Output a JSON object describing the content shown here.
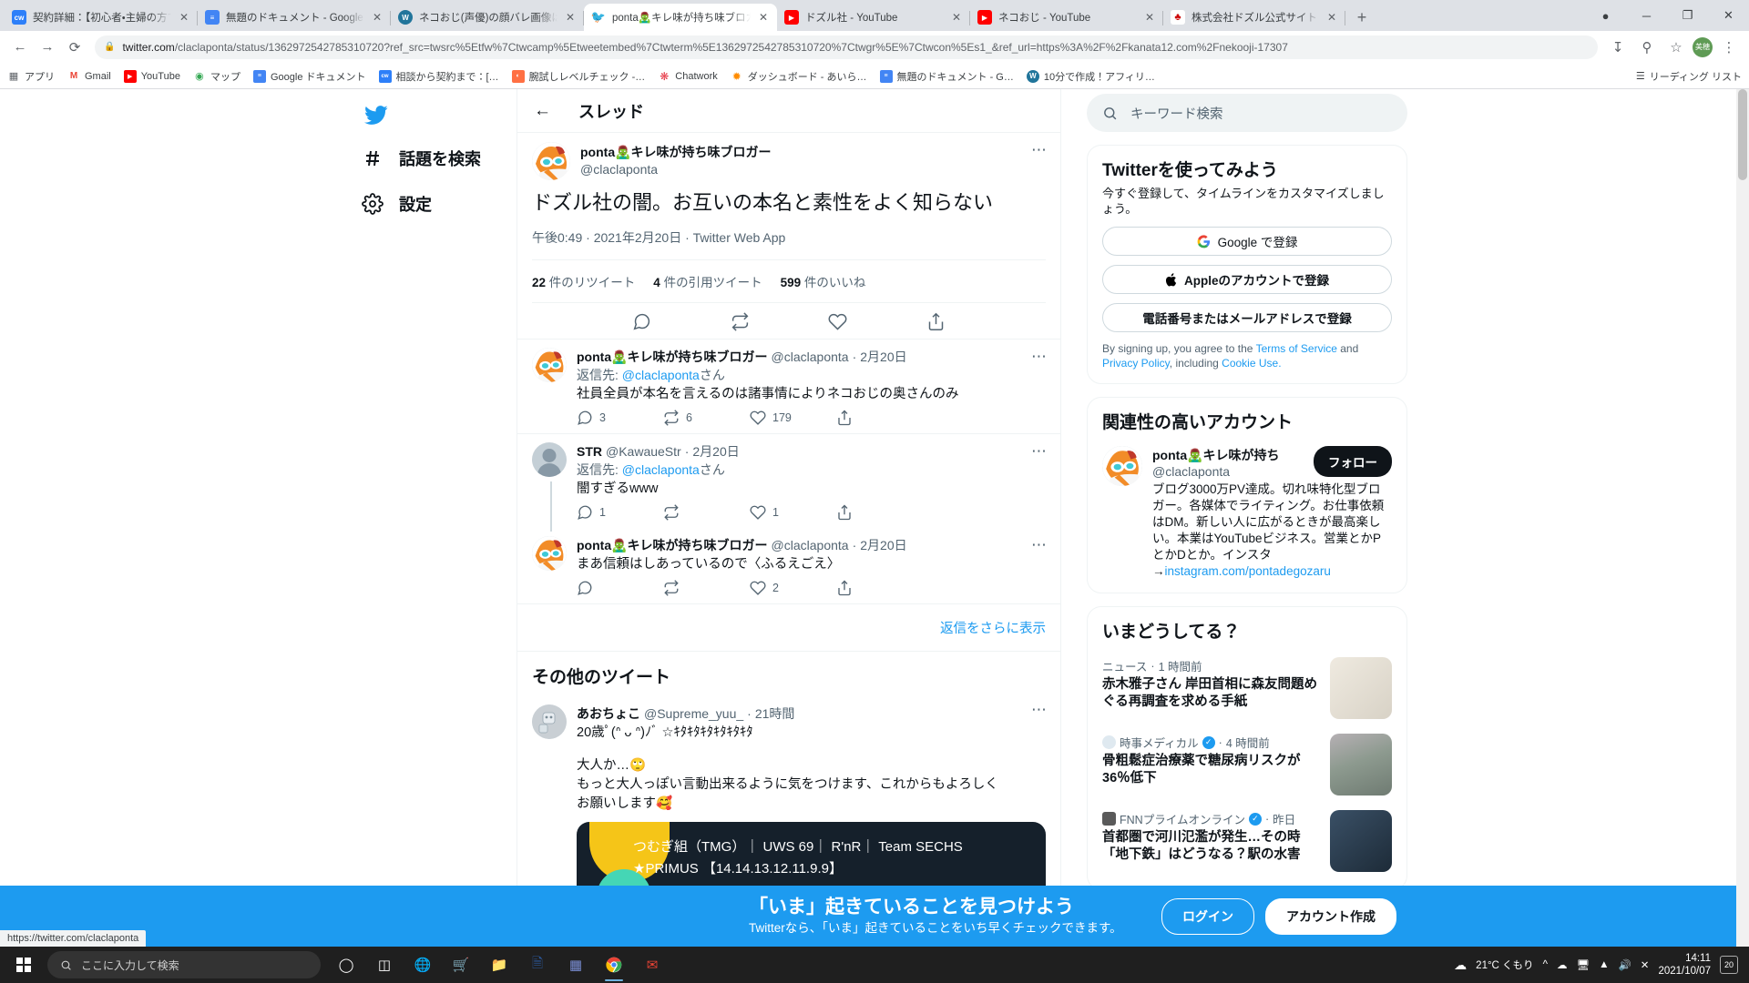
{
  "browser": {
    "tabs": [
      {
        "title": "契約詳細：【初心者・主婦の方でも",
        "favicon_text": "cw",
        "favicon_color": "#2d7ff9",
        "active": false
      },
      {
        "title": "無題のドキュメント - Google ドキュメ",
        "favicon_text": "≡",
        "favicon_color": "#4285f4",
        "active": false
      },
      {
        "title": "ネコおじ(声優)の顔バレ画像は？年",
        "favicon_text": "W",
        "favicon_color": "#21759b",
        "active": false
      },
      {
        "title": "ponta🧟‍♂️キレ味が持ち味ブロガーさん",
        "favicon_text": "t",
        "favicon_color": "#1d9bf0",
        "active": true
      },
      {
        "title": "ドズル社 - YouTube",
        "favicon_text": "▶",
        "favicon_color": "#ff0000",
        "active": false
      },
      {
        "title": "ネコおじ - YouTube",
        "favicon_text": "▶",
        "favicon_color": "#ff0000",
        "active": false
      },
      {
        "title": "株式会社ドズル公式サイト | クリエイ",
        "favicon_text": "♣",
        "favicon_color": "#e8e8e8",
        "active": false
      }
    ],
    "close_label": "✕",
    "newtab_label": "+",
    "window_controls": {
      "minimize": "─",
      "maximize": "❐",
      "close": "✕"
    },
    "url_host": "twitter.com",
    "url_rest": "/claclaponta/status/1362972542785310720?ref_src=twsrc%5Etfw%7Ctwcamp%5Etweetembed%7Ctwterm%5E1362972542785310720%7Ctwgr%5E%7Ctwcon%5Es1_&ref_url=https%3A%2F%2Fkanata12.com%2Fnekooji-17307",
    "nav": {
      "back": "←",
      "forward": "→",
      "reload": "⟳"
    },
    "lock_icon": "🔒",
    "profile_initial": "美穂",
    "bookmarks": [
      {
        "label": "アプリ",
        "icon": "⁞⁞⁞",
        "color": "transparent"
      },
      {
        "label": "Gmail",
        "icon": "M",
        "color": "#ffffff"
      },
      {
        "label": "YouTube",
        "icon": "▶",
        "color": "#ff0000"
      },
      {
        "label": "マップ",
        "icon": "◈",
        "color": "#ffffff"
      },
      {
        "label": "Google ドキュメント",
        "icon": "≡",
        "color": "#4285f4"
      },
      {
        "label": "相談から契約まで：[…",
        "icon": "cw",
        "color": "#2d7ff9"
      },
      {
        "label": "腕試しレベルチェック -…",
        "icon": "◐",
        "color": "#ff7043"
      },
      {
        "label": "Chatwork",
        "icon": "❋",
        "color": "#ffffff"
      },
      {
        "label": "ダッシュボード - あいら…",
        "icon": "✹",
        "color": "#ff8c00"
      },
      {
        "label": "無題のドキュメント - G…",
        "icon": "≡",
        "color": "#4285f4"
      },
      {
        "label": "10分で作成！アフィリ…",
        "icon": "W",
        "color": "#21759b"
      }
    ],
    "reading_list": "リーディング リスト",
    "status_bar_url": "https://twitter.com/claclaponta"
  },
  "leftnav": {
    "logo": "twitter-bird",
    "items": [
      {
        "icon": "#",
        "label": "話題を検索"
      },
      {
        "icon": "gear",
        "label": "設定"
      }
    ]
  },
  "thread": {
    "header_title": "スレッド",
    "back_icon": "←",
    "main_tweet": {
      "display_name": "ponta🧟‍♂️キレ味が持ち味ブロガー",
      "handle": "@claclaponta",
      "text": "ドズル社の闇。お互いの本名と素性をよく知らない",
      "meta": "午後0:49 · 2021年2月20日 · Twitter Web App",
      "stats": [
        {
          "count": "22",
          "label": "件のリツイート"
        },
        {
          "count": "4",
          "label": "件の引用ツイート"
        },
        {
          "count": "599",
          "label": "件のいいね"
        }
      ],
      "actions": [
        "reply-icon",
        "retweet-icon",
        "like-icon",
        "share-icon"
      ]
    },
    "replies": [
      {
        "display_name": "ponta🧟‍♂️キレ味が持ち味ブロガー",
        "handle": "@claclaponta",
        "date": "2月20日",
        "reply_to_prefix": "返信先:",
        "reply_to": "@claclaponta",
        "reply_to_suffix": "さん",
        "text": "社員全員が本名を言えるのは諸事情によりネコおじの奥さんのみ",
        "avatar": "ponta",
        "show_reply_to": true,
        "thread_line": false,
        "counts": {
          "reply": "3",
          "retweet": "6",
          "like": "179",
          "share": ""
        }
      },
      {
        "display_name": "STR",
        "handle": "@KawaueStr",
        "date": "2月20日",
        "reply_to_prefix": "返信先:",
        "reply_to": "@claclaponta",
        "reply_to_suffix": "さん",
        "text": "闇すぎるwww",
        "avatar": "default",
        "show_reply_to": true,
        "thread_line": true,
        "counts": {
          "reply": "1",
          "retweet": "",
          "like": "1",
          "share": ""
        }
      },
      {
        "display_name": "ponta🧟‍♂️キレ味が持ち味ブロガー",
        "handle": "@claclaponta",
        "date": "2月20日",
        "reply_to_prefix": "",
        "reply_to": "",
        "reply_to_suffix": "",
        "text": "まあ信頼はしあっているので〈ふるえごえ〉",
        "avatar": "ponta",
        "show_reply_to": false,
        "thread_line": false,
        "counts": {
          "reply": "",
          "retweet": "",
          "like": "2",
          "share": ""
        }
      }
    ],
    "show_more_replies": "返信をさらに表示",
    "other_tweets_title": "その他のツイート",
    "other_tweet": {
      "display_name": "あおちょこ",
      "handle": "@Supreme_yuu_",
      "date": "21時間",
      "bio_line": "20歳ﾟ(ᐢ ᴗ ᐢ)ﾉﾞ ☆ｷﾀｷﾀｷﾀｷﾀｷﾀｷﾀ",
      "text_lines": [
        "大人か…🙄",
        "もっと大人っぽい言動出来るように気をつけます、これからもよろしく",
        "お願いします🥰"
      ],
      "card_line1": "つむぎ組（TMG）｜ UWS 69｜ R'nR｜ Team SECHS",
      "card_line2": "★PRIMUS 【14.14.13.12.11.9.9】"
    }
  },
  "sidebar": {
    "search_placeholder": "キーワード検索",
    "search_icon": "search-icon",
    "signup_card": {
      "title": "Twitterを使ってみよう",
      "subtitle": "今すぐ登録して、タイムラインをカスタマイズしましょう。",
      "google_button": "Google で登録",
      "apple_button": "Appleのアカウントで登録",
      "phone_button": "電話番号またはメールアドレスで登録",
      "legal_pre": "By signing up, you agree to the ",
      "legal_tos": "Terms of Service",
      "legal_and": " and ",
      "legal_privacy": "Privacy Policy",
      "legal_incl": ", including ",
      "legal_cookie": "Cookie Use."
    },
    "relevant_accounts": {
      "title": "関連性の高いアカウント",
      "account": {
        "display_name": "ponta🧟‍♂️キレ味が持ち",
        "handle": "@claclaponta",
        "follow_label": "フォロー",
        "bio": "ブログ3000万PV達成。切れ味特化型ブロガー。各媒体でライティング。お仕事依頼はDM。新しい人に広がるときが最高楽しい。本業はYouTubeビジネス。営業とかPとかDとか。インスタ",
        "link_arrow": "→",
        "link": "instagram.com/pontadegozaru"
      }
    },
    "trends": {
      "title": "いまどうしてる？",
      "items": [
        {
          "source": "ニュース",
          "verified": false,
          "has_icon": false,
          "time": "1 時間前",
          "headline": "赤木雅子さん 岸田首相に森友問題めぐる再調査を求める手紙",
          "thumb_color": "#e8e2d8"
        },
        {
          "source": "時事メディカル",
          "verified": true,
          "has_icon": true,
          "time": "4 時間前",
          "headline": "骨粗鬆症治療薬で糖尿病リスクが36％低下",
          "thumb_color": "#9aa9a0"
        },
        {
          "source": "FNNプライムオンライン",
          "verified": true,
          "has_icon": true,
          "time": "昨日",
          "headline": "首都圏で河川氾濫が発生…その時「地下鉄」はどうなる？駅の水害",
          "thumb_color": "#2b3f52"
        }
      ]
    }
  },
  "signup_banner": {
    "headline": "「いま」起きていることを見つけよう",
    "subtext": "Twitterなら、「いま」起きていることをいち早くチェックできます。",
    "login_label": "ログイン",
    "signup_label": "アカウント作成",
    "accent": "#1d9bf0"
  },
  "taskbar": {
    "search_placeholder": "ここに入力して検索",
    "start_icon": "windows-icon",
    "icons": [
      "cortana-icon",
      "taskview-icon",
      "edge-icon",
      "store-icon",
      "explorer-icon",
      "word-icon",
      "excel-icon",
      "chrome-icon",
      "gmail-icon"
    ],
    "weather": "21°C くもり",
    "time": "14:11",
    "date": "2021/10/07",
    "notif_count": "20",
    "tray_icons": [
      "up-chevron-icon",
      "onedrive-icon",
      "display-icon",
      "network-icon",
      "volume-icon",
      "close-icon"
    ]
  }
}
